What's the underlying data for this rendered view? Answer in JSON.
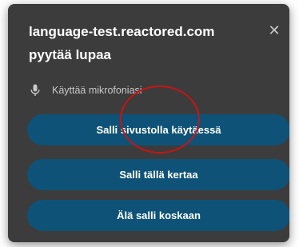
{
  "dialog": {
    "title_line1": "language-test.reactored.com",
    "title_line2": "pyytää lupaa",
    "close_glyph": "✕",
    "permission": {
      "icon": "microphone-icon",
      "label": "Käyttää mikrofoniasi"
    },
    "buttons": [
      {
        "label": "Salli sivustolla käytäessä"
      },
      {
        "label": "Salli tällä kertaa"
      },
      {
        "label": "Älä salli koskaan"
      }
    ]
  },
  "colors": {
    "background": "#3c3c3c",
    "button": "#0e5278",
    "annotation": "#c81414"
  }
}
